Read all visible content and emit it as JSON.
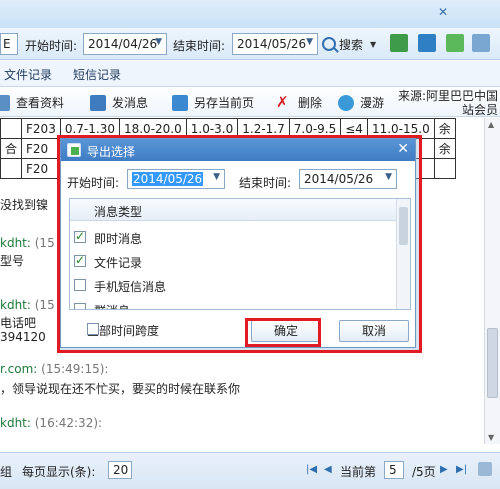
{
  "search": {
    "start_label": "开始时间:",
    "start_value": "2014/04/26",
    "end_label": "结束时间:",
    "end_value": "2014/05/26",
    "search_label": "搜索",
    "partial_left": "E"
  },
  "tabs": [
    {
      "label": "文件记录"
    },
    {
      "label": "短信记录"
    }
  ],
  "actions": [
    {
      "label": "查看资料"
    },
    {
      "label": "发消息"
    },
    {
      "label": "另存当前页"
    },
    {
      "label": "删除"
    },
    {
      "label": "漫游"
    }
  ],
  "source_text": "来源:阿里巴巴中国站会员",
  "table": {
    "rows": [
      [
        "",
        "F203",
        "0.7-1.30",
        "18.0-20.0",
        "1.0-3.0",
        "1.2-1.7",
        "7.0-9.5",
        "≤4",
        "11.0-15.0",
        "余"
      ],
      [
        "合",
        "F20",
        "",
        "",
        "",
        "",
        "",
        "",
        "",
        "余"
      ],
      [
        "",
        "F20",
        "",
        "",
        "",
        "",
        "",
        "",
        "",
        ""
      ]
    ]
  },
  "chat": {
    "lines": [
      {
        "text": "没找到镍",
        "kind": "plain"
      },
      {
        "sender": "kdht:",
        "time": "(15",
        "kind": "sender"
      },
      {
        "text": "型号",
        "kind": "plain"
      },
      {
        "sender": "kdht:",
        "time": "(15",
        "kind": "sender"
      },
      {
        "text": "电话吧",
        "kind": "plain"
      },
      {
        "text": "394120",
        "kind": "plain"
      },
      {
        "sender": "r.com:",
        "time": "(15:49:15):",
        "kind": "sender"
      },
      {
        "text": "，领导说现在还不忙买，要买的时候在联系你",
        "kind": "plain"
      },
      {
        "sender": "kdht:",
        "time": "(16:42:32):",
        "kind": "sender"
      }
    ]
  },
  "bottom": {
    "group_label": "组",
    "per_page_label": "每页显示(条):",
    "per_page_value": "20",
    "current_label": "当前第",
    "current_value": "5",
    "total_label": "/5页"
  },
  "modal": {
    "title": "导出选择",
    "start_label": "开始时间:",
    "start_value": "2014/05/26",
    "end_label": "结束时间:",
    "end_value": "2014/05/26",
    "list_header": "消息类型",
    "items": [
      {
        "label": "即时消息",
        "checked": true
      },
      {
        "label": "文件记录",
        "checked": true
      },
      {
        "label": "手机短信消息",
        "checked": false
      },
      {
        "label": "群消息",
        "checked": false
      }
    ],
    "all_span_label": "全部时间跨度",
    "ok_label": "确定",
    "cancel_label": "取消"
  }
}
